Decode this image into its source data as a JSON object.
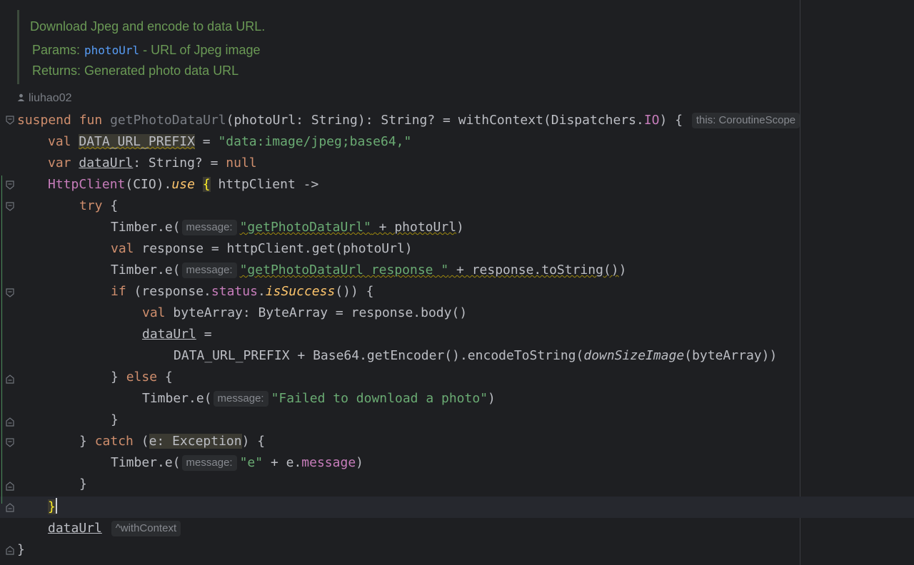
{
  "doc": {
    "summary": "Download Jpeg and encode to data URL.",
    "params_label": "Params:",
    "param_name": "photoUrl",
    "param_desc": "- URL of Jpeg image",
    "returns_label": "Returns:",
    "returns_desc": "Generated photo data URL"
  },
  "author": "liuhao02",
  "hints": {
    "this_scope": "this: CoroutineScope",
    "message": "message:",
    "with_context": "^withContext"
  },
  "code": {
    "l1_suspend": "suspend",
    "l1_fun": "fun",
    "l1_name": "getPhotoDataUrl",
    "l1_params": "(photoUrl: String): String? = withContext(Dispatchers.",
    "l1_io": "IO",
    "l1_end": ") {",
    "l2_val": "val",
    "l2_name": "DATA_URL_PREFIX",
    "l2_eq": " = ",
    "l2_str": "\"data:image/jpeg;base64,\"",
    "l3_var": "var",
    "l3_name": "dataUrl",
    "l3_type": ": String? = ",
    "l3_null": "null",
    "l4_cls": "HttpClient",
    "l4_mid": "(CIO).",
    "l4_use": "use",
    "l4_brace": "{",
    "l4_end": " httpClient ->",
    "l5_try": "try",
    "l5_end": " {",
    "l6_a": "Timber.e(",
    "l6_str": "\"getPhotoDataUrl\"",
    "l6_b": " + photoUrl",
    "l6_c": ")",
    "l7_val": "val",
    "l7_rest": " response = httpClient.get(photoUrl)",
    "l8_a": "Timber.e(",
    "l8_str": "\"getPhotoDataUrl response \"",
    "l8_b": " + response.toString()",
    "l8_c": ")",
    "l9_if": "if",
    "l9_a": " (response.",
    "l9_status": "status",
    "l9_dot": ".",
    "l9_ext": "isSuccess",
    "l9_end": "()) {",
    "l10_val": "val",
    "l10_rest": " byteArray: ByteArray = response.body()",
    "l11_name": "dataUrl",
    "l11_eq": " =",
    "l12_a": "DATA_URL_PREFIX + Base64.getEncoder().encodeToString(",
    "l12_fn": "downSizeImage",
    "l12_end": "(byteArray))",
    "l13_a": "} ",
    "l13_else": "else",
    "l13_end": " {",
    "l14_a": "Timber.e(",
    "l14_str": "\"Failed to download a photo\"",
    "l14_end": ")",
    "l15": "}",
    "l16_a": "} ",
    "l16_catch": "catch",
    "l16_b": " (",
    "l16_exc": "e: Exception",
    "l16_end": ") {",
    "l17_a": "Timber.e(",
    "l17_str": "\"e\"",
    "l17_b": " + e.",
    "l17_msg": "message",
    "l17_end": ")",
    "l18": "}",
    "l19": "}",
    "l20_name": "dataUrl",
    "l21": "}"
  }
}
